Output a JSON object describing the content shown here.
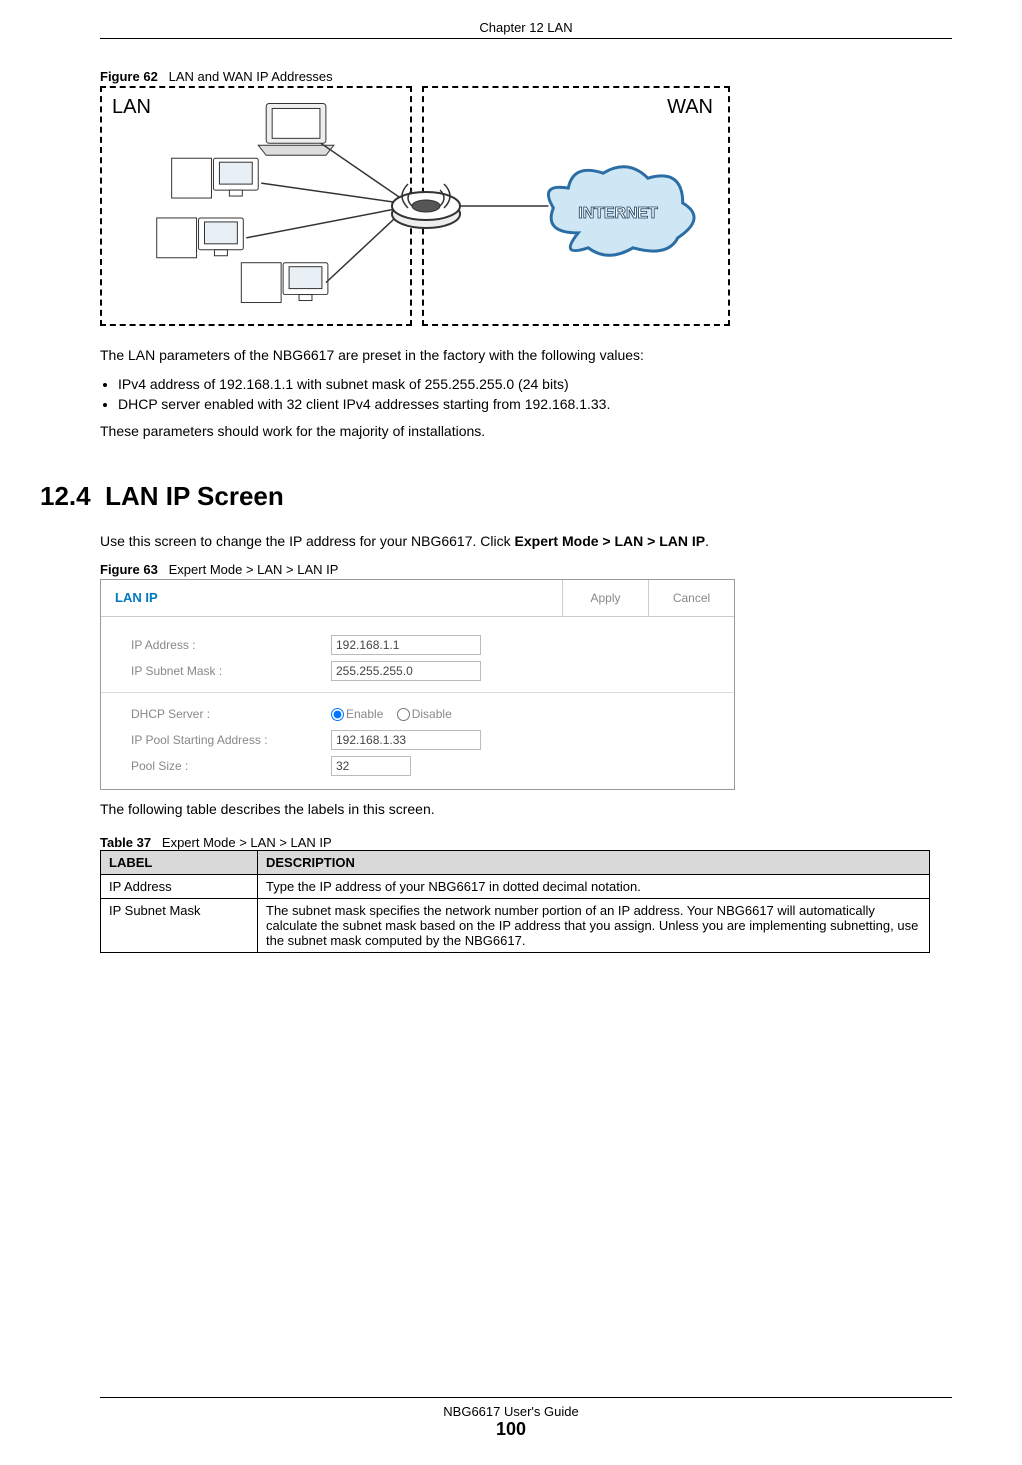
{
  "header": {
    "chapter": "Chapter 12 LAN"
  },
  "figure62": {
    "caption_label": "Figure 62",
    "caption_text": "LAN and WAN IP Addresses",
    "lan_label": "LAN",
    "wan_label": "WAN",
    "internet_label": "INTERNET"
  },
  "body": {
    "intro": "The LAN parameters of the NBG6617 are preset in the factory with the following values:",
    "bullets": [
      "IPv4 address of 192.168.1.1 with subnet mask of 255.255.255.0 (24 bits)",
      "DHCP server enabled with 32 client IPv4 addresses starting from 192.168.1.33."
    ],
    "note": "These parameters should work for the majority of installations."
  },
  "section": {
    "number": "12.4",
    "title": "LAN IP Screen",
    "intro_pre": "Use this screen to change the IP address for your NBG6617. Click ",
    "intro_bold": "Expert Mode > LAN > LAN IP",
    "intro_post": "."
  },
  "figure63": {
    "caption_label": "Figure 63",
    "caption_text": "Expert Mode > LAN > LAN IP",
    "panel_title": "LAN IP",
    "apply": "Apply",
    "cancel": "Cancel",
    "labels": {
      "ip_address": "IP Address :",
      "ip_subnet": "IP Subnet Mask :",
      "dhcp": "DHCP Server :",
      "pool_start": "IP Pool Starting Address :",
      "pool_size": "Pool Size :"
    },
    "values": {
      "ip_address": "192.168.1.1",
      "ip_subnet": "255.255.255.0",
      "pool_start": "192.168.1.33",
      "pool_size": "32"
    },
    "radio": {
      "enable": "Enable",
      "disable": "Disable"
    }
  },
  "table37": {
    "intro": "The following table describes the labels in this screen.",
    "caption_label": "Table 37",
    "caption_text": "Expert Mode > LAN > LAN IP",
    "headers": {
      "label": "LABEL",
      "desc": "DESCRIPTION"
    },
    "rows": [
      {
        "label": "IP Address",
        "desc": "Type the IP address of your NBG6617 in dotted decimal notation."
      },
      {
        "label": "IP Subnet Mask",
        "desc": "The subnet mask specifies the network number portion of an IP address. Your NBG6617 will automatically calculate the subnet mask based on the IP address that you assign. Unless you are implementing subnetting, use the subnet mask computed by the NBG6617."
      }
    ]
  },
  "footer": {
    "guide": "NBG6617 User's Guide",
    "page": "100"
  }
}
